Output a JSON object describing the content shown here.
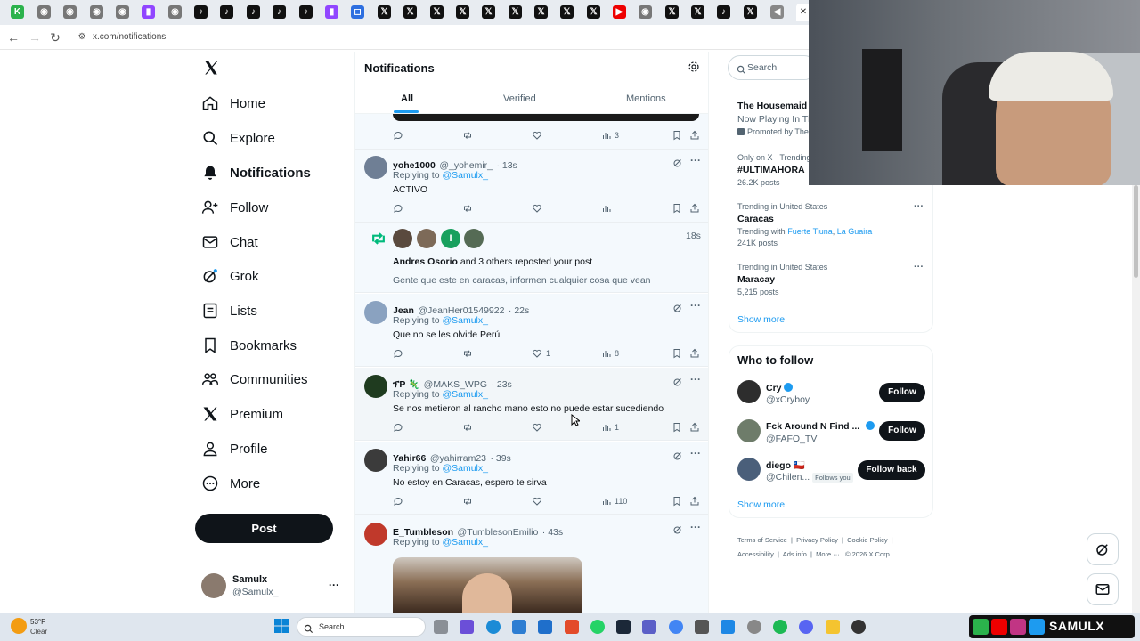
{
  "browser": {
    "url": "x.com/notifications",
    "tab_icons": [
      "k-icon",
      "chrome-icon",
      "chrome-icon",
      "chrome-icon",
      "chrome-icon",
      "twitch-icon",
      "chrome-icon",
      "tiktok-icon",
      "tiktok-icon",
      "tiktok-icon",
      "tiktok-icon",
      "tiktok-icon",
      "twitch-icon",
      "app-icon",
      "x-icon",
      "x-icon",
      "x-icon",
      "x-icon",
      "x-icon",
      "x-icon",
      "x-icon",
      "x-icon",
      "x-icon",
      "x-icon",
      "youtube-icon",
      "chrome-icon",
      "x-icon",
      "x-icon",
      "tiktok-icon",
      "x-icon",
      "speaker-icon"
    ],
    "close_tab": "✕"
  },
  "nav": {
    "items": [
      {
        "label": "Home",
        "icon": "home-icon"
      },
      {
        "label": "Explore",
        "icon": "search-icon"
      },
      {
        "label": "Notifications",
        "icon": "bell-icon"
      },
      {
        "label": "Follow",
        "icon": "add-user-icon"
      },
      {
        "label": "Chat",
        "icon": "mail-icon"
      },
      {
        "label": "Grok",
        "icon": "grok-icon"
      },
      {
        "label": "Lists",
        "icon": "list-icon"
      },
      {
        "label": "Bookmarks",
        "icon": "bookmark-icon"
      },
      {
        "label": "Communities",
        "icon": "communities-icon"
      },
      {
        "label": "Premium",
        "icon": "x-logo-icon"
      },
      {
        "label": "Profile",
        "icon": "person-icon"
      },
      {
        "label": "More",
        "icon": "more-circle-icon"
      }
    ],
    "post_label": "Post",
    "account": {
      "name": "Samulx",
      "handle": "@Samulx_",
      "more": "···"
    }
  },
  "header": {
    "title": "Notifications",
    "tabs": [
      {
        "label": "All"
      },
      {
        "label": "Verified"
      },
      {
        "label": "Mentions"
      }
    ]
  },
  "feed": {
    "top_actions": {
      "views": "3"
    },
    "items": [
      {
        "type": "reply",
        "name": "yohe1000",
        "handle": "@_yohemir_",
        "time": "· 13s",
        "replying": "Replying to",
        "mention": "@Samulx_",
        "text": "ACTIVO",
        "likes": "",
        "views": ""
      },
      {
        "type": "repost",
        "time": "18s",
        "actor": "Andres Osorio",
        "rest": " and 3 others reposted your post",
        "text": "Gente que este en caracas, informen cualquier cosa que vean",
        "badge": "I"
      },
      {
        "type": "reply",
        "name": "Jean",
        "handle": "@JeanHer01549922",
        "time": "· 22s",
        "replying": "Replying to",
        "mention": "@Samulx_",
        "text": "Que no se les olvide Perú",
        "likes": "1",
        "views": "8"
      },
      {
        "type": "reply",
        "name": "ፕP 🦎",
        "handle": "@MAKS_WPG",
        "time": "· 23s",
        "replying": "Replying to",
        "mention": "@Samulx_",
        "text": "Se nos metieron al rancho mano esto no puede estar sucediendo",
        "likes": "",
        "views": "1"
      },
      {
        "type": "reply",
        "name": "Yahir66",
        "handle": "@yahirram23",
        "time": "· 39s",
        "replying": "Replying to",
        "mention": "@Samulx_",
        "text": "No estoy en Caracas, espero te sirva",
        "likes": "",
        "views": "110"
      },
      {
        "type": "reply",
        "name": "E_Tumbleson",
        "handle": "@TumblesonEmilio",
        "time": "· 43s",
        "replying": "Replying to",
        "mention": "@Samulx_",
        "text": "",
        "likes": "",
        "views": ""
      }
    ]
  },
  "right": {
    "search_placeholder": "Search",
    "promo": {
      "title": "The Housemaid",
      "line": "Now Playing In Th",
      "promoted": "Promoted by The"
    },
    "trends": [
      {
        "context": "Only on X · Trending",
        "title": "#ULTIMAHORA",
        "posts": "26.2K posts"
      },
      {
        "context": "Trending in United States",
        "title": "Caracas",
        "with_label": "Trending with",
        "with_1": "Fuerte Tiuna",
        "with_2": "La Guaira",
        "posts": "241K posts"
      },
      {
        "context": "Trending in United States",
        "title": "Maracay",
        "posts": "5,215 posts"
      }
    ],
    "show_more": "Show more",
    "who_to_follow": {
      "title": "Who to follow",
      "users": [
        {
          "name": "Cry",
          "handle": "@xCryboy",
          "button": "Follow"
        },
        {
          "name": "Fck Around N Find ...",
          "handle": "@FAFO_TV",
          "button": "Follow"
        },
        {
          "name": "diego 🇨🇱",
          "handle": "@Chilen...",
          "follows_you": "Follows you",
          "button": "Follow back"
        }
      ],
      "show_more": "Show more"
    },
    "footer": [
      "Terms of Service",
      "Privacy Policy",
      "Cookie Policy",
      "Accessibility",
      "Ads info",
      "More ···",
      "© 2026 X Corp."
    ]
  },
  "taskbar": {
    "weather_temp": "53°F",
    "weather_desc": "Clear",
    "search_label": "Search",
    "overlay_text": "SAMULX"
  },
  "colors": {
    "accent": "#1d9bf0",
    "dark": "#0f1419",
    "muted": "#536471",
    "repost_green": "#00ba7c",
    "unread_bg": "#f4f9fd"
  }
}
